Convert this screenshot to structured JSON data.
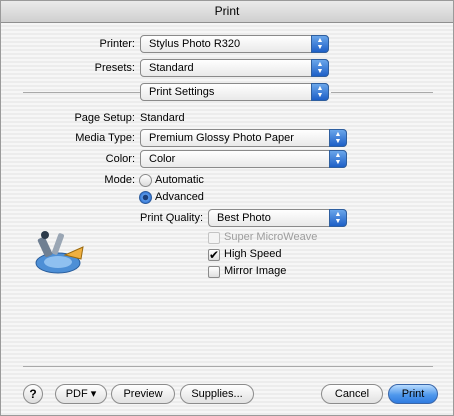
{
  "window": {
    "title": "Print"
  },
  "printer": {
    "label": "Printer:",
    "value": "Stylus Photo R320"
  },
  "presets": {
    "label": "Presets:",
    "value": "Standard"
  },
  "panel": {
    "value": "Print Settings"
  },
  "page_setup": {
    "label": "Page Setup:",
    "value": "Standard"
  },
  "media_type": {
    "label": "Media Type:",
    "value": "Premium Glossy Photo Paper"
  },
  "color": {
    "label": "Color:",
    "value": "Color"
  },
  "mode": {
    "label": "Mode:",
    "options": [
      {
        "label": "Automatic",
        "selected": false
      },
      {
        "label": "Advanced",
        "selected": true
      }
    ]
  },
  "print_quality": {
    "label": "Print Quality:",
    "value": "Best Photo"
  },
  "checkboxes": [
    {
      "label": "Super MicroWeave",
      "checked": false,
      "enabled": false
    },
    {
      "label": "High Speed",
      "checked": true,
      "enabled": true
    },
    {
      "label": "Mirror Image",
      "checked": false,
      "enabled": true
    }
  ],
  "icons": {
    "help": "help-icon",
    "printer_settings": "printer-settings-icon"
  },
  "buttons": {
    "help": "?",
    "pdf": "PDF ▾",
    "preview": "Preview",
    "supplies": "Supplies...",
    "cancel": "Cancel",
    "print": "Print"
  },
  "colors": {
    "accent": "#2f7be0"
  }
}
